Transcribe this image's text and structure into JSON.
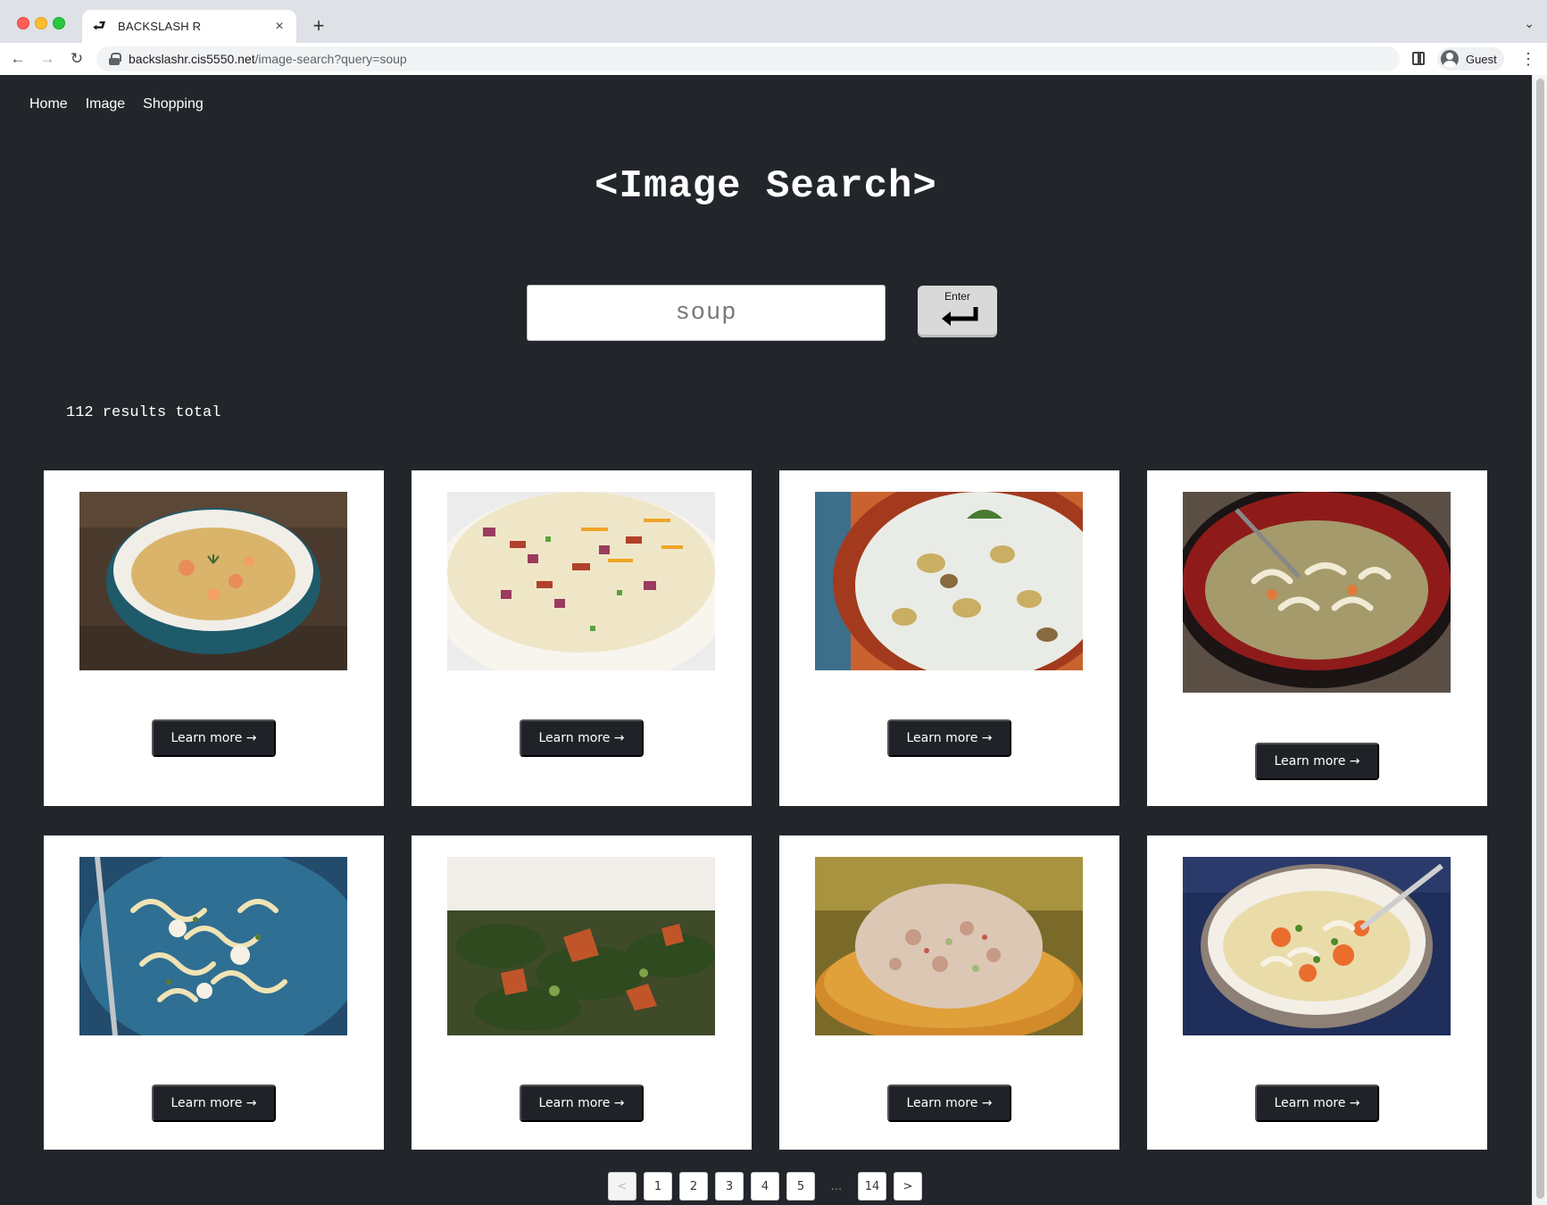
{
  "browser": {
    "tab_title": "BACKSLASH R",
    "url_host": "backslashr.cis5550.net",
    "url_path": "/image-search?query=soup",
    "profile_label": "Guest"
  },
  "nav": {
    "items": [
      {
        "label": "Home"
      },
      {
        "label": "Image"
      },
      {
        "label": "Shopping"
      }
    ]
  },
  "page": {
    "heading": "<Image Search>",
    "search_value": "soup",
    "enter_label": "Enter",
    "results_total": "112 results total"
  },
  "results": [
    {
      "image": "salmon-chowder",
      "button_label": "Learn more →"
    },
    {
      "image": "loaded-potato-soup",
      "button_label": "Learn more →"
    },
    {
      "image": "creamy-potato-soup",
      "button_label": "Learn more →"
    },
    {
      "image": "chicken-noodle-red-bowl",
      "button_label": "Learn more →"
    },
    {
      "image": "chicken-noodle-casserole",
      "button_label": "Learn more →"
    },
    {
      "image": "greens-tomato-soup",
      "button_label": "Learn more →"
    },
    {
      "image": "tuna-salad-cracker",
      "button_label": "Learn more →"
    },
    {
      "image": "chicken-noodle-soup-bowl",
      "button_label": "Learn more →"
    }
  ],
  "pagination": {
    "prev": "<",
    "pages": [
      "1",
      "2",
      "3",
      "4",
      "5"
    ],
    "ellipsis": "...",
    "last": "14",
    "next": ">"
  }
}
